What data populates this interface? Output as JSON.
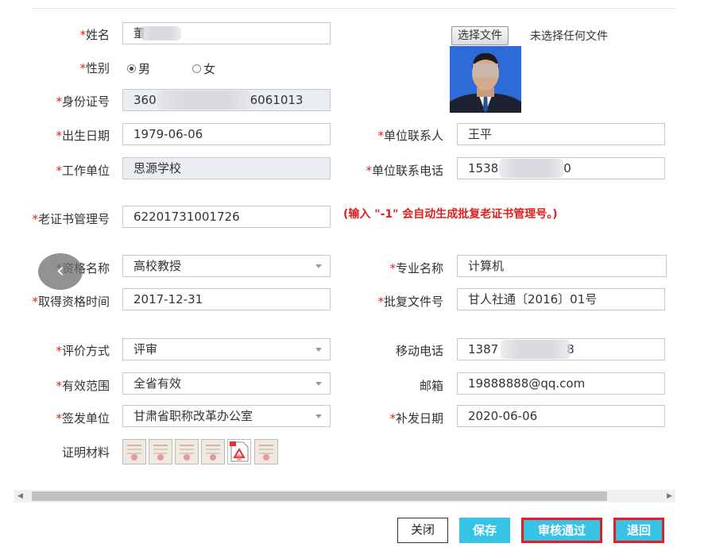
{
  "file_upload": {
    "button_label": "选择文件",
    "status_text": "未选择任何文件"
  },
  "labels": {
    "name": "姓名",
    "gender": "性别",
    "id_number": "身份证号",
    "birth_date": "出生日期",
    "unit_contact": "单位联系人",
    "work_unit": "工作单位",
    "unit_phone": "单位联系电话",
    "cert_number": "老证书管理号",
    "qualification": "资格名称",
    "major": "专业名称",
    "qual_date": "取得资格时间",
    "approval_doc": "批复文件号",
    "eval_method": "评价方式",
    "mobile": "移动电话",
    "valid_scope": "有效范围",
    "email": "邮箱",
    "issuer": "签发单位",
    "reissue_date": "补发日期",
    "materials": "证明材料"
  },
  "required_mark": "*",
  "values": {
    "name": "董",
    "gender_options": [
      "男",
      "女"
    ],
    "gender_selected": "男",
    "id_number_prefix": "360",
    "id_number_suffix": "6061013",
    "birth_date": "1979-06-06",
    "unit_contact": "王平",
    "work_unit": "思源学校",
    "unit_phone_prefix": "1538",
    "unit_phone_suffix": "0",
    "cert_number": "62201731001726",
    "qualification": "高校教授",
    "major": "计算机",
    "qual_date": "2017-12-31",
    "approval_doc": "甘人社通〔2016〕01号",
    "eval_method": "评审",
    "mobile_prefix": "1387",
    "mobile_suffix": "8",
    "valid_scope": "全省有效",
    "email": "19888888@qq.com",
    "issuer": "甘肃省职称改革办公室",
    "reissue_date": "2020-06-06"
  },
  "hint": "(输入 \"-1\" 会自动生成批复老证书管理号。)",
  "buttons": {
    "close": "关闭",
    "save": "保存",
    "approve": "审核通过",
    "back": "退回"
  },
  "colors": {
    "accent": "#36c3e6",
    "required": "#e02020",
    "highlight_border": "#e02020"
  }
}
